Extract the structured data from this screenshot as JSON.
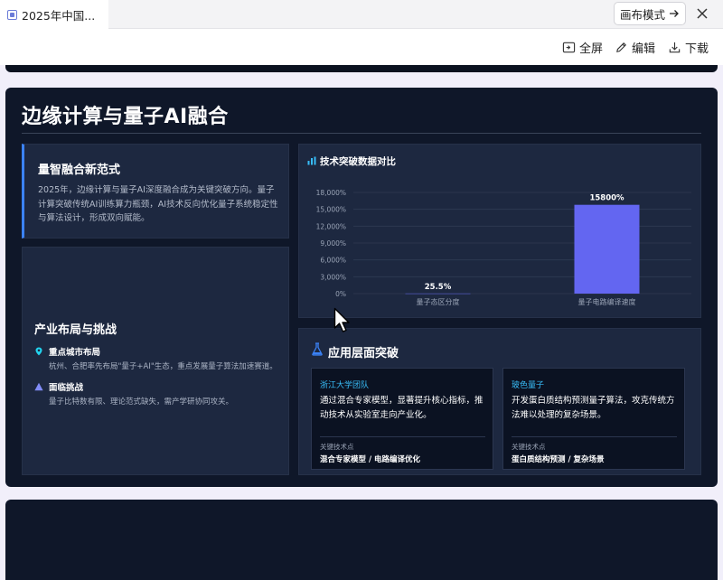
{
  "tab": {
    "title": "2025年中国..."
  },
  "toolbar": {
    "canvas_mode": "画布模式",
    "fullscreen": "全屏",
    "edit": "编辑",
    "download": "下载"
  },
  "slide": {
    "title": "边缘计算与量子AI融合",
    "paradigm": {
      "heading": "量智融合新范式",
      "text": "2025年，边缘计算与量子AI深度融合成为关键突破方向。量子计算突破传统AI训练算力瓶颈，AI技术反向优化量子系统稳定性与算法设计，形成双向赋能。"
    },
    "industry": {
      "heading": "产业布局与挑战",
      "cities_title": "重点城市布局",
      "cities_text": "杭州、合肥率先布局\"量子+AI\"生态，重点发展量子算法加速赛道。",
      "challenge_title": "面临挑战",
      "challenge_text": "量子比特数有限、理论范式缺失，需产学研协同攻关。"
    },
    "chart_panel": {
      "heading": "技术突破数据对比"
    },
    "applications": {
      "heading": "应用层面突破",
      "cards": [
        {
          "tag": "浙江大学团队",
          "text": "通过混合专家模型，显著提升核心指标，推动技术从实验室走向产业化。",
          "key_label": "关键技术点",
          "key_value": "混合专家模型 / 电路编译优化"
        },
        {
          "tag": "玻色量子",
          "text": "开发蛋白质结构预测量子算法，攻克传统方法难以处理的复杂场景。",
          "key_label": "关键技术点",
          "key_value": "蛋白质结构预测 / 复杂场景"
        }
      ]
    }
  },
  "chart_data": {
    "type": "bar",
    "title": "技术突破数据对比",
    "categories": [
      "量子态区分度",
      "量子电路编译速度"
    ],
    "values": [
      25.5,
      15800
    ],
    "data_labels": [
      "25.5%",
      "15800%"
    ],
    "ylim": [
      0,
      18000
    ],
    "yticks": [
      0,
      3000,
      6000,
      9000,
      12000,
      15000,
      18000
    ],
    "ytick_labels": [
      "0%",
      "3,000%",
      "6,000%",
      "9,000%",
      "12,000%",
      "15,000%",
      "18,000%"
    ],
    "bar_color": "#6366f1",
    "grid": true
  },
  "colors": {
    "slide_bg": "#0f1729",
    "panel_bg": "#1d2840",
    "accent_blue": "#3b82f6",
    "accent_cyan": "#38bdf8",
    "bar": "#6366f1"
  }
}
